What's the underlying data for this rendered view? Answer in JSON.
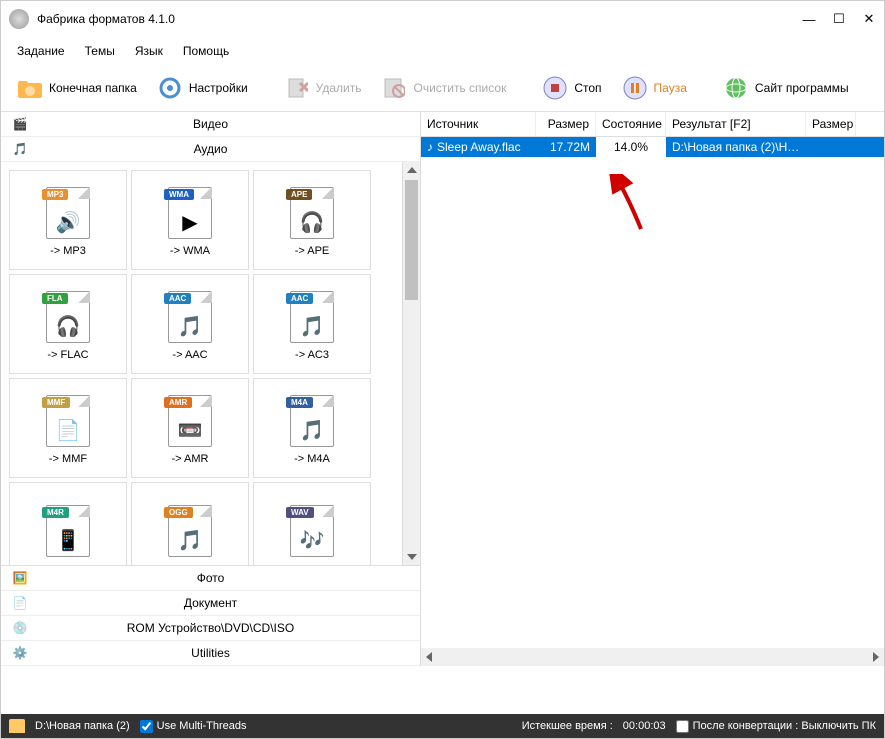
{
  "app": {
    "title": "Фабрика форматов 4.1.0"
  },
  "menu": {
    "task": "Задание",
    "themes": "Темы",
    "language": "Язык",
    "help": "Помощь"
  },
  "toolbar": {
    "output_folder": "Конечная папка",
    "settings": "Настройки",
    "delete": "Удалить",
    "clear_list": "Очистить список",
    "stop": "Стоп",
    "pause": "Пауза",
    "website": "Сайт программы"
  },
  "categories": {
    "video": "Видео",
    "audio": "Аудио",
    "photo": "Фото",
    "document": "Документ",
    "rom": "ROM Устройство\\DVD\\CD\\ISO",
    "utilities": "Utilities"
  },
  "formats": [
    [
      {
        "tag": "MP3",
        "color": "#e89030",
        "label": "-> MP3",
        "glyph": "🔊"
      },
      {
        "tag": "WMA",
        "color": "#2060c0",
        "label": "-> WMA",
        "glyph": "▶"
      },
      {
        "tag": "APE",
        "color": "#705020",
        "label": "-> APE",
        "glyph": "🎧"
      }
    ],
    [
      {
        "tag": "FLA",
        "color": "#30a040",
        "label": "-> FLAC",
        "glyph": "🎧"
      },
      {
        "tag": "AAC",
        "color": "#2080c0",
        "label": "-> AAC",
        "glyph": "🎵"
      },
      {
        "tag": "AAC",
        "color": "#2080c0",
        "label": "-> AC3",
        "glyph": "🎵"
      }
    ],
    [
      {
        "tag": "MMF",
        "color": "#c0a040",
        "label": "-> MMF",
        "glyph": "📄"
      },
      {
        "tag": "AMR",
        "color": "#e07020",
        "label": "-> AMR",
        "glyph": "📼"
      },
      {
        "tag": "M4A",
        "color": "#3060a0",
        "label": "-> M4A",
        "glyph": "🎵"
      }
    ],
    [
      {
        "tag": "M4R",
        "color": "#20a080",
        "label": "",
        "glyph": "📱"
      },
      {
        "tag": "OGG",
        "color": "#e08020",
        "label": "",
        "glyph": "🎵"
      },
      {
        "tag": "WAV",
        "color": "#505080",
        "label": "",
        "glyph": "🎶"
      }
    ]
  ],
  "list": {
    "headers": {
      "source": "Источник",
      "size": "Размер",
      "state": "Состояние",
      "result": "Результат [F2]",
      "rsize": "Размер"
    },
    "rows": [
      {
        "source": "Sleep Away.flac",
        "size": "17.72M",
        "state": "14.0%",
        "result": "D:\\Новая папка (2)\\Но..."
      }
    ]
  },
  "status": {
    "folder": "D:\\Новая папка (2)",
    "multithreads": "Use Multi-Threads",
    "elapsed_label": "Истекшее время :",
    "elapsed_value": "00:00:03",
    "shutdown": "После конвертации : Выключить ПК"
  }
}
